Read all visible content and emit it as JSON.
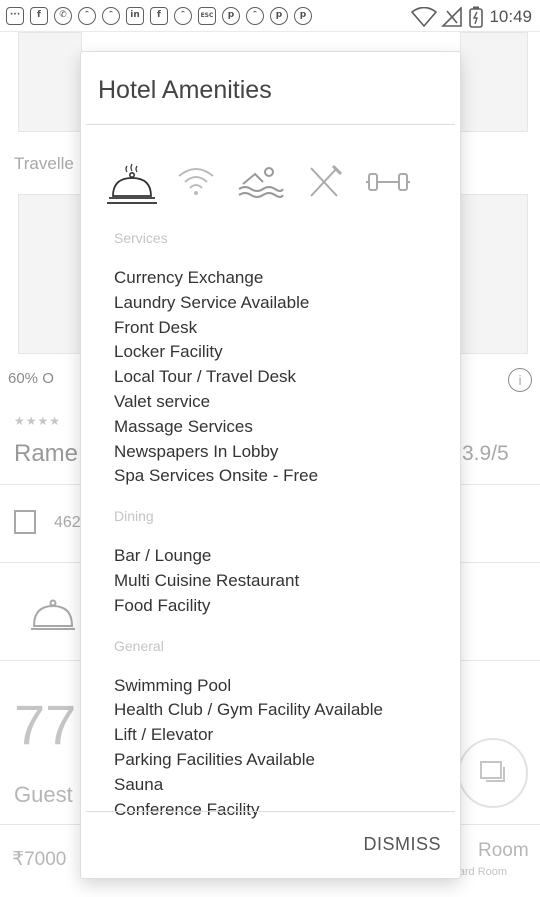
{
  "status_bar": {
    "left_icons": [
      "message-icon",
      "facebook-icon",
      "whatsapp-icon",
      "cat-icon",
      "cat-icon",
      "linkedin-icon",
      "facebook-icon",
      "cat-icon",
      "esc-icon",
      "pinterest-icon",
      "cat-icon",
      "pinterest-icon",
      "pinterest-icon"
    ],
    "esc_label": "ESC",
    "time": "10:49"
  },
  "background": {
    "section_label": "Travelle",
    "discount_badge": "60% O",
    "hotel_name": "Rame",
    "rating": "3.9/5",
    "address": "462",
    "guests_number": "77",
    "guests_label": "Guest",
    "price": "₹7000",
    "room_label": "Room",
    "room_sub": "Standard Room"
  },
  "dialog": {
    "title": "Hotel Amenities",
    "category_icons": [
      "service-bell-icon",
      "wifi-icon",
      "swimming-icon",
      "dining-icon",
      "dumbbell-icon"
    ],
    "sections": [
      {
        "label": "Services",
        "items": [
          "Currency Exchange",
          "Laundry Service Available",
          "Front Desk",
          "Locker Facility",
          "Local Tour / Travel Desk",
          "Valet service",
          "Massage Services",
          "Newspapers In Lobby",
          "Spa Services Onsite - Free"
        ]
      },
      {
        "label": "Dining",
        "items": [
          "Bar / Lounge",
          "Multi Cuisine Restaurant",
          "Food Facility"
        ]
      },
      {
        "label": "General",
        "items": [
          "Swimming Pool",
          "Health Club / Gym Facility Available",
          "Lift / Elevator",
          "Parking Facilities Available",
          "Sauna",
          "Conference Facility"
        ]
      }
    ],
    "dismiss_label": "DISMISS"
  }
}
